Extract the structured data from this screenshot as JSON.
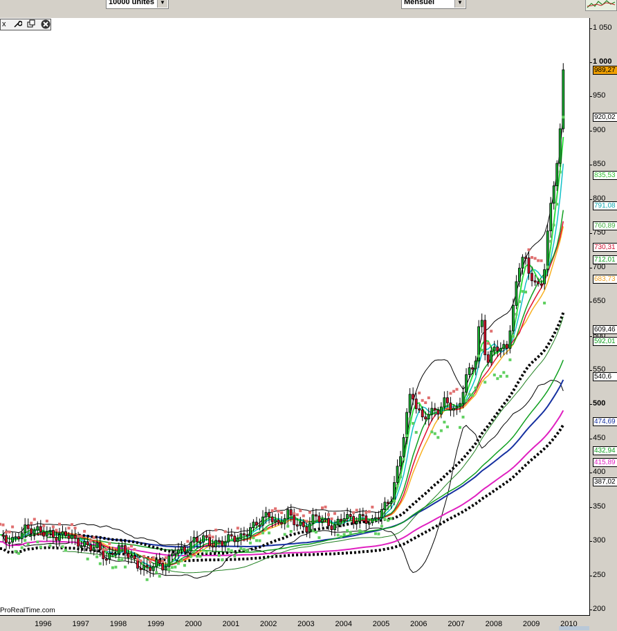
{
  "toolbar": {
    "units_select": "10000 unités",
    "period_select": "Mensuel",
    "tools_labels": [
      "x"
    ]
  },
  "watermark": "ProRealTime.com",
  "colors": {
    "candle_up": "#18b030",
    "candle_down": "#d8102a",
    "ma_black": "#000000",
    "ma_blue": "#1530a0",
    "ma_green": "#10a020",
    "ma_magenta": "#e020c0",
    "ma_red": "#e01030",
    "ma_orange": "#f8b020",
    "ma_cyan": "#10c0c8",
    "ma_lightgreen": "#30e040",
    "sar_up": "#60d060",
    "sar_down": "#e07070",
    "price_label": "#f0a000"
  },
  "chart_data": {
    "type": "candlestick",
    "period": "monthly",
    "x": {
      "min": 1995.35,
      "max": 2010.75,
      "ticks": [
        "1996",
        "1997",
        "1998",
        "1999",
        "2000",
        "2001",
        "2002",
        "2003",
        "2004",
        "2005",
        "2006",
        "2007",
        "2008",
        "2009",
        "2010"
      ]
    },
    "y": {
      "min": 190,
      "max": 1070,
      "ticks": [
        "1 050",
        "1 000",
        "950",
        "900",
        "850",
        "800",
        "750",
        "700",
        "650",
        "600",
        "550",
        "500",
        "450",
        "400",
        "350",
        "300",
        "250",
        "200"
      ]
    },
    "last_values": [
      {
        "name": "price",
        "value": "989,27",
        "color": "#f0a000"
      },
      {
        "name": "bollinger_upper",
        "value": "920,02",
        "color": "#000000"
      },
      {
        "name": "ma_lightgreen",
        "value": "835,53",
        "color": "#30c030"
      },
      {
        "name": "ma_cyan",
        "value": "791,08",
        "color": "#10a8b0"
      },
      {
        "name": "sar",
        "value": "760,89",
        "color": "#40b040"
      },
      {
        "name": "ma_red",
        "value": "730,31",
        "color": "#d01030"
      },
      {
        "name": "ma_green",
        "value": "712,01",
        "color": "#10a020"
      },
      {
        "name": "ma_orange",
        "value": "683,73",
        "color": "#f0a020"
      },
      {
        "name": "ma_black_dotted",
        "value": "609,46",
        "color": "#000000"
      },
      {
        "name": "ma_thin_green",
        "value": "592,01",
        "color": "#10a020"
      },
      {
        "name": "bollinger_lower",
        "value": "540,6",
        "color": "#000000"
      },
      {
        "name": "ma_blue",
        "value": "474,69",
        "color": "#1530a0"
      },
      {
        "name": "ma_green_long",
        "value": "432,94",
        "color": "#10a020"
      },
      {
        "name": "ma_magenta",
        "value": "415,89",
        "color": "#e020c0"
      },
      {
        "name": "ma_black_long",
        "value": "387,02",
        "color": "#000000"
      }
    ],
    "price_anchors": [
      [
        1995.4,
        305
      ],
      [
        1995.7,
        300
      ],
      [
        1996.0,
        318
      ],
      [
        1996.3,
        316
      ],
      [
        1996.6,
        312
      ],
      [
        1996.9,
        305
      ],
      [
        1997.1,
        312
      ],
      [
        1997.4,
        298
      ],
      [
        1997.7,
        292
      ],
      [
        1997.95,
        292
      ],
      [
        1998.2,
        272
      ],
      [
        1998.5,
        292
      ],
      [
        1998.75,
        282
      ],
      [
        1999.0,
        265
      ],
      [
        1999.25,
        258
      ],
      [
        1999.5,
        268
      ],
      [
        1999.75,
        262
      ],
      [
        2000.0,
        288
      ],
      [
        2000.25,
        285
      ],
      [
        2000.5,
        300
      ],
      [
        2000.75,
        305
      ],
      [
        2001.0,
        295
      ],
      [
        2001.25,
        298
      ],
      [
        2001.5,
        306
      ],
      [
        2001.75,
        304
      ],
      [
        2002.0,
        318
      ],
      [
        2002.25,
        328
      ],
      [
        2002.5,
        340
      ],
      [
        2002.75,
        322
      ],
      [
        2003.0,
        342
      ],
      [
        2003.25,
        325
      ],
      [
        2003.5,
        318
      ],
      [
        2003.75,
        338
      ],
      [
        2004.0,
        328
      ],
      [
        2004.25,
        320
      ],
      [
        2004.5,
        338
      ],
      [
        2004.75,
        330
      ],
      [
        2005.0,
        335
      ],
      [
        2005.25,
        326
      ],
      [
        2005.5,
        345
      ],
      [
        2005.75,
        360
      ],
      [
        2006.0,
        420
      ],
      [
        2006.15,
        475
      ],
      [
        2006.3,
        520
      ],
      [
        2006.45,
        495
      ],
      [
        2006.6,
        478
      ],
      [
        2006.75,
        488
      ],
      [
        2007.0,
        490
      ],
      [
        2007.2,
        505
      ],
      [
        2007.4,
        495
      ],
      [
        2007.55,
        490
      ],
      [
        2007.75,
        540
      ],
      [
        2008.0,
        560
      ],
      [
        2008.15,
        635
      ],
      [
        2008.3,
        560
      ],
      [
        2008.5,
        580
      ],
      [
        2008.65,
        585
      ],
      [
        2008.85,
        580
      ],
      [
        2009.0,
        640
      ],
      [
        2009.15,
        690
      ],
      [
        2009.3,
        730
      ],
      [
        2009.45,
        680
      ],
      [
        2009.6,
        685
      ],
      [
        2009.75,
        665
      ],
      [
        2009.85,
        700
      ],
      [
        2009.95,
        770
      ],
      [
        2010.1,
        815
      ],
      [
        2010.25,
        890
      ],
      [
        2010.35,
        989
      ]
    ]
  }
}
